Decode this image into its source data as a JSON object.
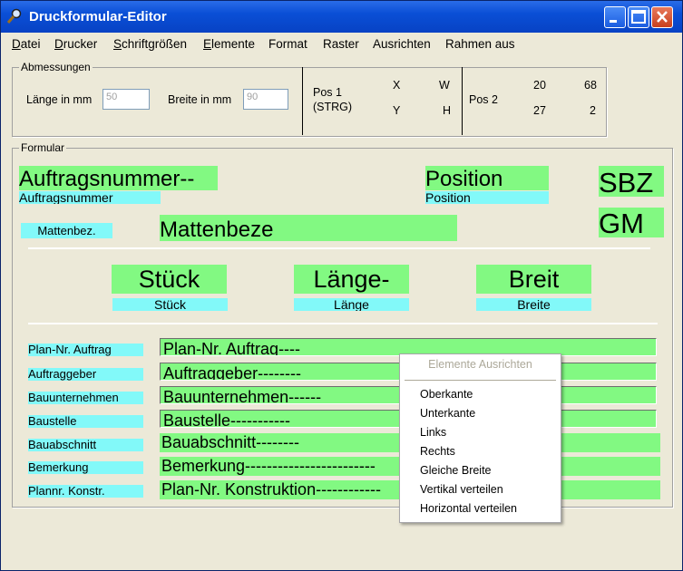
{
  "window": {
    "title": "Druckformular-Editor"
  },
  "menubar": {
    "items": [
      {
        "underline": "D",
        "rest": "atei"
      },
      {
        "underline": "D",
        "rest": "rucker"
      },
      {
        "underline": "S",
        "rest": "chriftgrößen"
      },
      {
        "underline": "E",
        "rest": "lemente"
      },
      {
        "underline": "",
        "rest": "Format"
      },
      {
        "underline": "",
        "rest": "Raster"
      },
      {
        "underline": "",
        "rest": "Ausrichten"
      },
      {
        "underline": "",
        "rest": "Rahmen aus"
      }
    ]
  },
  "abmessungen": {
    "group_label": "Abmessungen",
    "laenge_label": "Länge in mm",
    "laenge_value": "50",
    "breite_label": "Breite in mm",
    "breite_value": "90",
    "pos1_label": "Pos 1",
    "pos1_sub": "(STRG)",
    "x_label": "X",
    "y_label": "Y",
    "w_label": "W",
    "h_label": "H",
    "pos2_label": "Pos 2",
    "pos2_x": "20",
    "pos2_w": "68",
    "pos2_y": "27",
    "pos2_h": "2"
  },
  "formular": {
    "group_label": "Formular",
    "auftragsnummer_value": "Auftragsnummer--",
    "auftragsnummer_label": "Auftragsnummer",
    "position_value": "Position",
    "position_label": "Position",
    "sbz": "SBZ",
    "gm": "GM",
    "mattenbez_label": "Mattenbez.",
    "mattenbez_value": "Mattenbeze",
    "stueck_value": "Stück",
    "stueck_label": "Stück",
    "laenge_value": "Länge-",
    "laenge_label": "Länge",
    "breite_value": "Breit",
    "breite_label": "Breite",
    "rows": [
      {
        "label": "Plan-Nr. Auftrag",
        "value": "Plan-Nr. Auftrag----"
      },
      {
        "label": "Auftraggeber",
        "value": "Auftraggeber--------"
      },
      {
        "label": "Bauunternehmen",
        "value": "Bauunternehmen------"
      },
      {
        "label": "Baustelle",
        "value": "Baustelle-----------"
      },
      {
        "label": "Bauabschnitt",
        "value": "Bauabschnitt--------"
      },
      {
        "label": "Bemerkung",
        "value": "Bemerkung------------------------"
      },
      {
        "label": "Plannr. Konstr.",
        "value": "Plan-Nr. Konstruktion------------"
      }
    ]
  },
  "context_menu": {
    "header": "Elemente Ausrichten",
    "items": [
      "Oberkante",
      "Unterkante",
      "Links",
      "Rechts",
      "Gleiche Breite",
      "Vertikal verteilen",
      "Horizontal verteilen"
    ]
  },
  "icons": {
    "app": "magnifier-key-icon",
    "minimize": "minimize-icon",
    "maximize": "maximize-icon",
    "close": "close-icon"
  }
}
